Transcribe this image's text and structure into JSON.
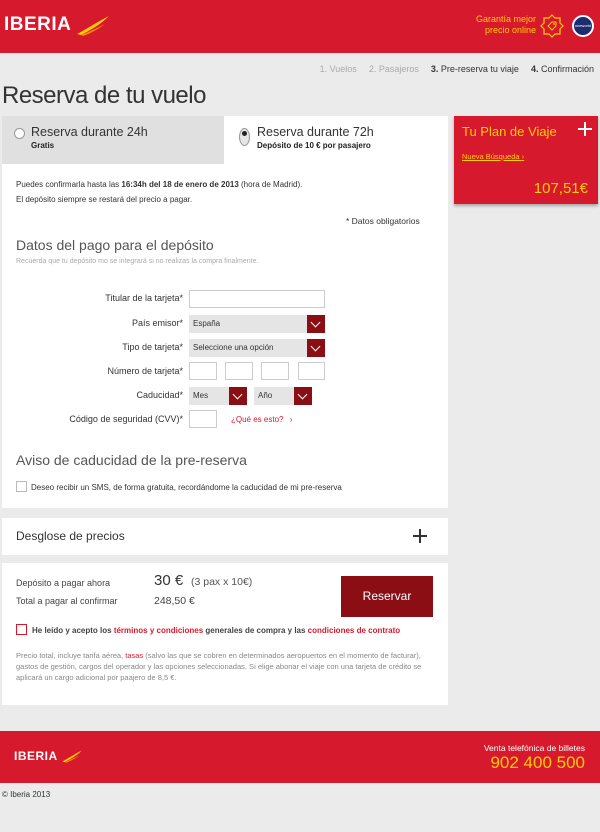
{
  "header": {
    "brand": "IBERIA",
    "guarantee_line1": "Garantía mejor",
    "guarantee_line2": "precio online",
    "oneworld": "oneworld"
  },
  "steps": [
    {
      "num": "1.",
      "label": "Vuelos",
      "state": "done"
    },
    {
      "num": "2.",
      "label": "Pasajeros",
      "state": "done"
    },
    {
      "num": "3.",
      "label": "Pre-reserva tu viaje",
      "state": "active"
    },
    {
      "num": "4.",
      "label": "Confirmación",
      "state": "active"
    }
  ],
  "page_title": "Reserva de tu vuelo",
  "tabs": {
    "t24": {
      "title": "Reserva durante 24h",
      "sub": "Gratis",
      "selected": false
    },
    "t72": {
      "title": "Reserva durante 72h",
      "sub": "Depósito de 10 € por pasajero",
      "selected": true
    }
  },
  "confirm": {
    "prefix": "Puedes confirmarla hasta las ",
    "deadline": "16:34h del 18 de enero de 2013",
    "suffix": " (hora de Madrid).",
    "line2": "El depósito siempre se restará del precio a pagar."
  },
  "required_note": "* Datos obligatorios",
  "payment": {
    "heading": "Datos del pago para el depósito",
    "hint": "Recuerda que tu depósito mo se integrará si no realizas la compra finalmente.",
    "holder_label": "Titular de la tarjeta*",
    "holder_value": "",
    "country_label": "País emisor*",
    "country_value": "España",
    "type_label": "Tipo de tarjeta*",
    "type_value": "Seleccione una opción",
    "number_label": "Número de tarjeta*",
    "expiry_label": "Caducidad*",
    "month_value": "Mes",
    "year_value": "Año",
    "cvv_label": "Código de seguridad (CVV)*",
    "cvv_link": "¿Qué es esto?"
  },
  "expiry_notice": {
    "heading": "Aviso de caducidad de la pre-reserva",
    "checkbox_label": "Deseo recibir un SMS, de forma gratuita, recordándome la caducidad de mi pre-reserva"
  },
  "plan": {
    "title": "Tu Plan de Viaje",
    "new_search": "Nueva Búsqueda",
    "price": "107,51€"
  },
  "breakdown": {
    "label": "Desglose de precios"
  },
  "totals": {
    "deposit_label": "Depósito a pagar ahora",
    "deposit_value": "30 €",
    "deposit_detail": "(3 pax x 10€)",
    "total_label": "Total a pagar al confirmar",
    "total_value": "248,50 €",
    "button": "Reservar"
  },
  "terms": {
    "part1": "He leído y acepto los ",
    "link1": "términos y condiciones",
    "part2": " generales de compra y las ",
    "link2": "condiciones de contrato"
  },
  "fine_print": {
    "part1": "Precio total, incluye tarifa aérea, ",
    "link": "tasas",
    "part2": " (salvo las que se cobren en determinados aeropuertos en el momento de facturar), gastos de gestión, cargos del operador y las opciones seleccionadas. Si elige abonar el viaje con una tarjeta de crédito se aplicará un cargo adicional por paajero de 8,5 €."
  },
  "footer": {
    "brand": "IBERIA",
    "phone_label": "Venta telefónica de billetes",
    "phone": "902 400 500",
    "copyright": "© Iberia 2013"
  },
  "colors": {
    "brand_red": "#d7192d",
    "dark_red": "#8b0e15",
    "accent_yellow": "#ffcc00"
  }
}
